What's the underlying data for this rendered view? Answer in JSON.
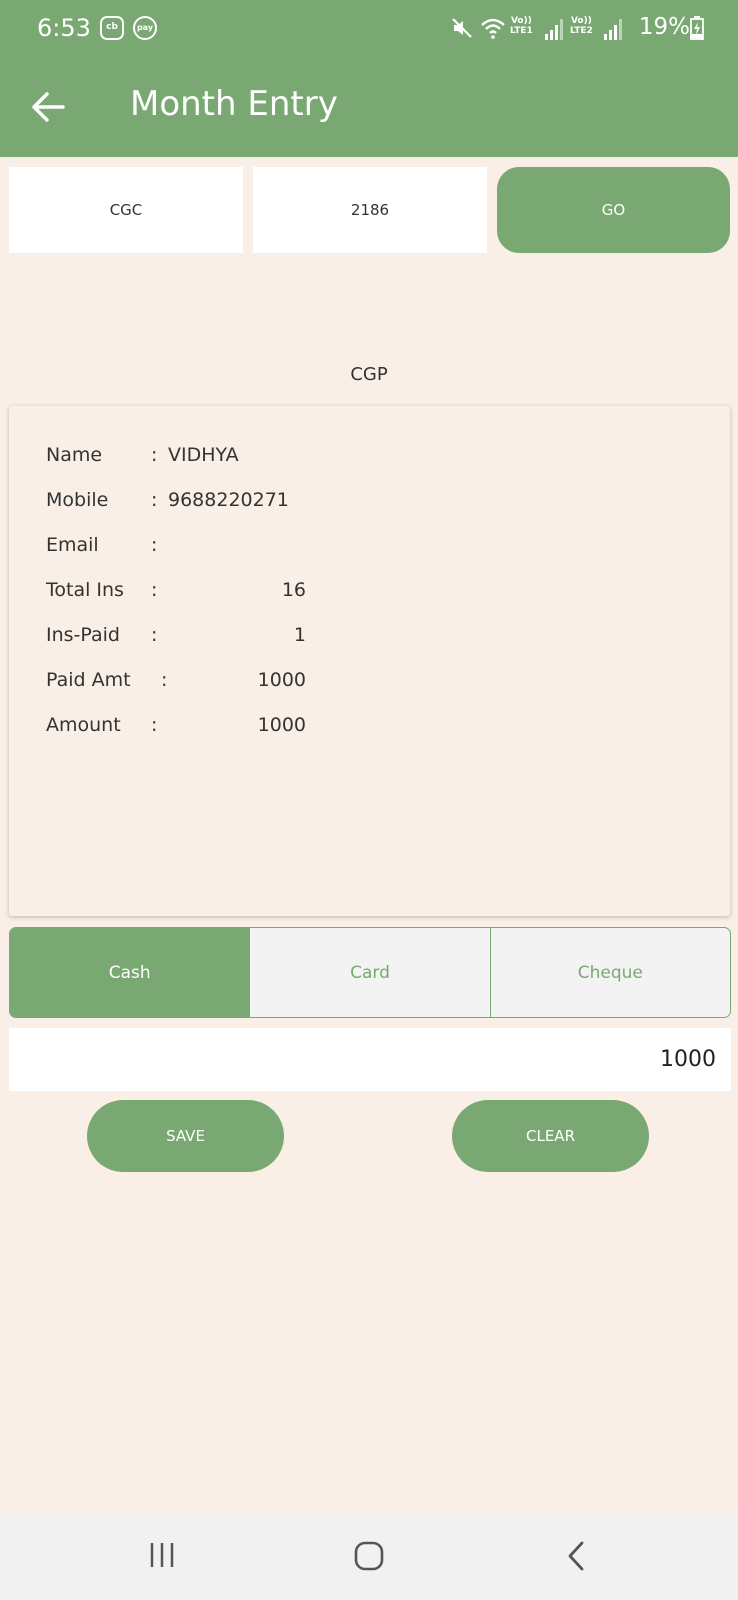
{
  "status_bar": {
    "time": "6:53",
    "app_icons": [
      "cb",
      "pay"
    ],
    "sim1_label_top": "Vo))",
    "sim1_label_bottom": "LTE1",
    "sim2_label_top": "Vo))",
    "sim2_label_bottom": "LTE2",
    "battery": "19%"
  },
  "app_bar": {
    "title": "Month Entry"
  },
  "search": {
    "group_value": "CGC",
    "ticket_value": "2186",
    "go_label": "GO"
  },
  "section_title": "CGP",
  "details": [
    {
      "label": "Name",
      "value": "VIDHYA"
    },
    {
      "label": "Mobile",
      "value": "9688220271"
    },
    {
      "label": "Email",
      "value": ""
    },
    {
      "label": "Total Ins",
      "value": "16"
    },
    {
      "label": "Ins-Paid",
      "value": "1"
    },
    {
      "label": "Paid Amt",
      "value": "1000"
    },
    {
      "label": "Amount",
      "value": "1000"
    }
  ],
  "payment_modes": [
    {
      "label": "Cash",
      "active": true
    },
    {
      "label": "Card",
      "active": false
    },
    {
      "label": "Cheque",
      "active": false
    }
  ],
  "amount_input": "1000",
  "actions": {
    "save_label": "SAVE",
    "clear_label": "CLEAR"
  },
  "colors": {
    "primary": "#79a872",
    "background": "#f9efe6"
  }
}
